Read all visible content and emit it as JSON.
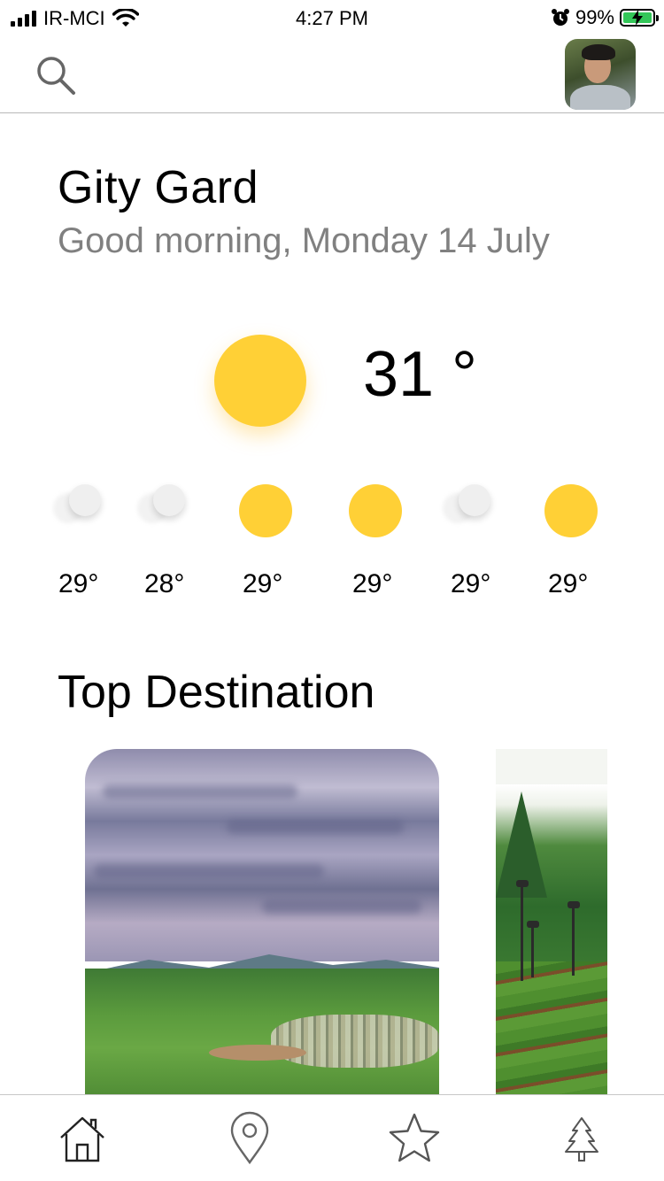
{
  "status_bar": {
    "carrier": "IR-MCI",
    "time": "4:27 PM",
    "battery_percent": "99%",
    "battery_level": 0.99,
    "icons": [
      "signal-icon",
      "wifi-icon",
      "alarm-icon",
      "battery-icon"
    ]
  },
  "header": {
    "search_icon": "search-icon",
    "avatar": "user-avatar"
  },
  "location": {
    "city": "Gity Gard",
    "greeting": "Good morning, Monday 14 July"
  },
  "current_weather": {
    "icon": "sun-icon",
    "temperature": "31 °"
  },
  "forecast": [
    {
      "icon": "cloud-icon",
      "temp": "29°"
    },
    {
      "icon": "cloud-icon",
      "temp": "28°"
    },
    {
      "icon": "sun-icon",
      "temp": "29°"
    },
    {
      "icon": "sun-icon",
      "temp": "29°"
    },
    {
      "icon": "cloud-icon",
      "temp": "29°"
    },
    {
      "icon": "sun-icon",
      "temp": "29°"
    }
  ],
  "section": {
    "title": "Top Destination"
  },
  "destinations": [
    {
      "image": "mountain-valley-village-photo"
    },
    {
      "image": "garden-park-photo"
    }
  ],
  "tabbar": [
    {
      "name": "home",
      "icon": "home-icon",
      "active": true
    },
    {
      "name": "location",
      "icon": "location-pin-icon",
      "active": false
    },
    {
      "name": "favorites",
      "icon": "star-icon",
      "active": false
    },
    {
      "name": "nature",
      "icon": "tree-icon",
      "active": false
    }
  ],
  "colors": {
    "sun": "#ffd036",
    "greeting_text": "#808080",
    "battery": "#34c759"
  }
}
